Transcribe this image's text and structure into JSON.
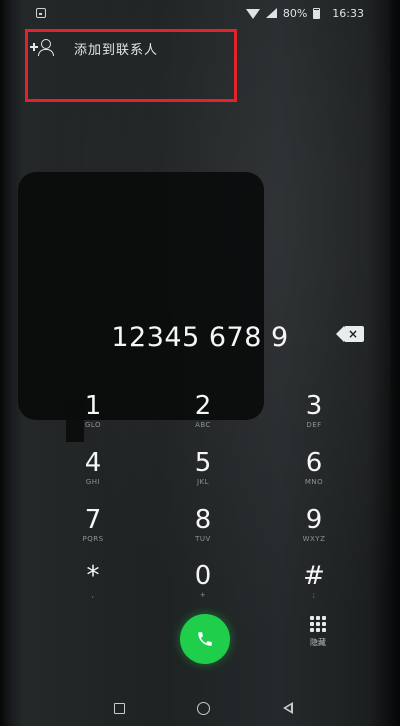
{
  "status_bar": {
    "battery_percent": "80%",
    "time": "16:33",
    "left_icon": "notification-icon",
    "icons": [
      "wifi-icon",
      "signal-icon",
      "battery-icon"
    ]
  },
  "add_contact": {
    "label": "添加到联系人",
    "icon": "add-person-icon",
    "highlight_color": "#e2232b"
  },
  "dialer": {
    "number": "12345 678 9",
    "backspace_icon": "backspace-icon"
  },
  "keypad": {
    "keys": [
      {
        "digit": "1",
        "letters": "GLO"
      },
      {
        "digit": "2",
        "letters": "ABC"
      },
      {
        "digit": "3",
        "letters": "DEF"
      },
      {
        "digit": "4",
        "letters": "GHI"
      },
      {
        "digit": "5",
        "letters": "JKL"
      },
      {
        "digit": "6",
        "letters": "MNO"
      },
      {
        "digit": "7",
        "letters": "PQRS"
      },
      {
        "digit": "8",
        "letters": "TUV"
      },
      {
        "digit": "9",
        "letters": "WXYZ"
      },
      {
        "digit": "*",
        "letters": ","
      },
      {
        "digit": "0",
        "letters": "+"
      },
      {
        "digit": "#",
        "letters": ";"
      }
    ]
  },
  "actions": {
    "call_icon": "phone-icon",
    "call_color": "#1fcf4b",
    "dialpad_toggle_label": "隐藏",
    "dialpad_toggle_icon": "dialpad-grid-icon"
  },
  "nav_bar": {
    "icons": [
      "square-icon",
      "circle-icon",
      "triangle-back-icon"
    ]
  }
}
